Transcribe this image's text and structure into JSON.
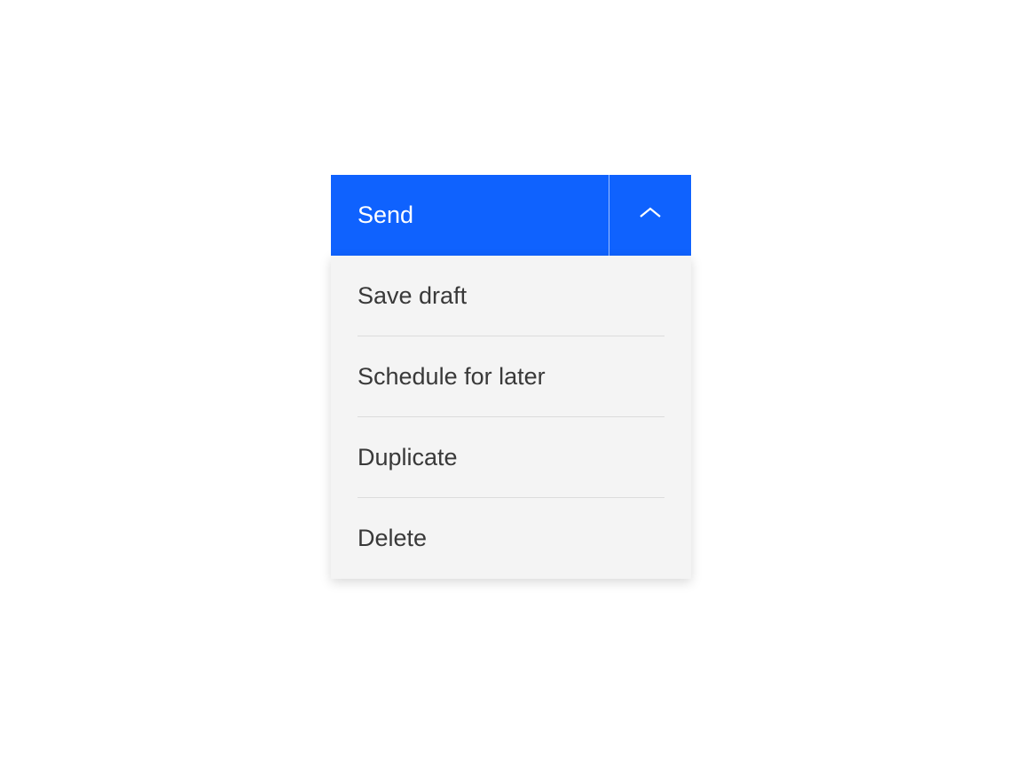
{
  "button": {
    "primary_label": "Send"
  },
  "menu": {
    "items": [
      {
        "label": "Save draft"
      },
      {
        "label": "Schedule for later"
      },
      {
        "label": "Duplicate"
      },
      {
        "label": "Delete"
      }
    ]
  }
}
